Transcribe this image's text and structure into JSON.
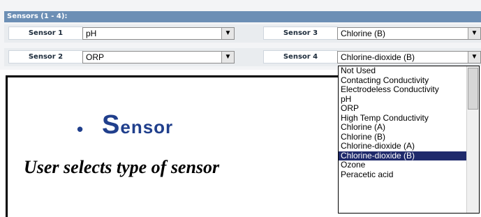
{
  "panel": {
    "header": "Sensors (1 - 4):",
    "rows": [
      {
        "label_left": "Sensor 1",
        "value_left": "pH",
        "label_right": "Sensor 3",
        "value_right": "Chlorine (B)"
      },
      {
        "label_left": "Sensor 2",
        "value_left": "ORP",
        "label_right": "Sensor 4",
        "value_right": "Chlorine-dioxide (B)"
      }
    ]
  },
  "slide": {
    "bullet": "•",
    "title_first": "S",
    "title_rest": "ensor",
    "subtitle": "User selects type of sensor"
  },
  "dropdown": {
    "options": [
      "Not Used",
      "Contacting Conductivity",
      "Electrodeless Conductivity",
      "pH",
      "ORP",
      "High Temp Conductivity",
      "Chlorine (A)",
      "Chlorine (B)",
      "Chlorine-dioxide (A)",
      "Chlorine-dioxide (B)",
      "Ozone",
      "Peracetic acid"
    ],
    "selected_index": 9
  },
  "colors": {
    "header_bg": "#6c8fb5",
    "title": "#203f8c",
    "selection": "#1f2a6b"
  },
  "icons": {
    "select_arrow": "dropdown-arrow-icon"
  }
}
